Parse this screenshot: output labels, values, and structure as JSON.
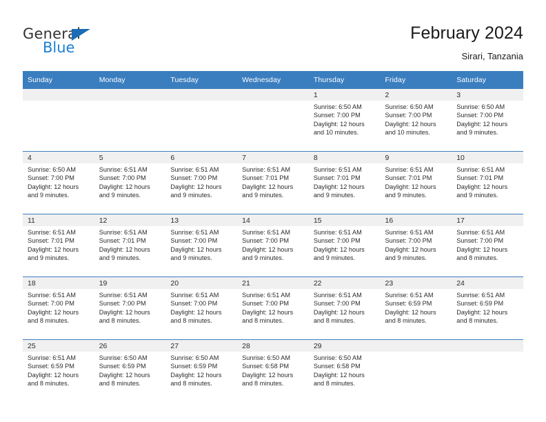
{
  "brand": {
    "name_top": "General",
    "name_bottom": "Blue",
    "triangle_color": "#1b6cb5",
    "blue_color": "#1b7fd4"
  },
  "header": {
    "title": "February 2024",
    "subtitle": "Sirari, Tanzania"
  },
  "theme": {
    "header_bg": "#3a7ebf",
    "daynum_band_bg": "#f0f0f0",
    "row_border": "#3a7ebf",
    "text": "#2b2b2b"
  },
  "weekdays": [
    "Sunday",
    "Monday",
    "Tuesday",
    "Wednesday",
    "Thursday",
    "Friday",
    "Saturday"
  ],
  "weeks": [
    [
      {
        "day": "",
        "empty": true,
        "sunrise": "",
        "sunset": "",
        "daylight_line1": "",
        "daylight_line2": ""
      },
      {
        "day": "",
        "empty": true,
        "sunrise": "",
        "sunset": "",
        "daylight_line1": "",
        "daylight_line2": ""
      },
      {
        "day": "",
        "empty": true,
        "sunrise": "",
        "sunset": "",
        "daylight_line1": "",
        "daylight_line2": ""
      },
      {
        "day": "",
        "empty": true,
        "sunrise": "",
        "sunset": "",
        "daylight_line1": "",
        "daylight_line2": ""
      },
      {
        "day": "1",
        "empty": false,
        "sunrise": "Sunrise: 6:50 AM",
        "sunset": "Sunset: 7:00 PM",
        "daylight_line1": "Daylight: 12 hours",
        "daylight_line2": "and 10 minutes."
      },
      {
        "day": "2",
        "empty": false,
        "sunrise": "Sunrise: 6:50 AM",
        "sunset": "Sunset: 7:00 PM",
        "daylight_line1": "Daylight: 12 hours",
        "daylight_line2": "and 10 minutes."
      },
      {
        "day": "3",
        "empty": false,
        "sunrise": "Sunrise: 6:50 AM",
        "sunset": "Sunset: 7:00 PM",
        "daylight_line1": "Daylight: 12 hours",
        "daylight_line2": "and 9 minutes."
      }
    ],
    [
      {
        "day": "4",
        "empty": false,
        "sunrise": "Sunrise: 6:50 AM",
        "sunset": "Sunset: 7:00 PM",
        "daylight_line1": "Daylight: 12 hours",
        "daylight_line2": "and 9 minutes."
      },
      {
        "day": "5",
        "empty": false,
        "sunrise": "Sunrise: 6:51 AM",
        "sunset": "Sunset: 7:00 PM",
        "daylight_line1": "Daylight: 12 hours",
        "daylight_line2": "and 9 minutes."
      },
      {
        "day": "6",
        "empty": false,
        "sunrise": "Sunrise: 6:51 AM",
        "sunset": "Sunset: 7:00 PM",
        "daylight_line1": "Daylight: 12 hours",
        "daylight_line2": "and 9 minutes."
      },
      {
        "day": "7",
        "empty": false,
        "sunrise": "Sunrise: 6:51 AM",
        "sunset": "Sunset: 7:01 PM",
        "daylight_line1": "Daylight: 12 hours",
        "daylight_line2": "and 9 minutes."
      },
      {
        "day": "8",
        "empty": false,
        "sunrise": "Sunrise: 6:51 AM",
        "sunset": "Sunset: 7:01 PM",
        "daylight_line1": "Daylight: 12 hours",
        "daylight_line2": "and 9 minutes."
      },
      {
        "day": "9",
        "empty": false,
        "sunrise": "Sunrise: 6:51 AM",
        "sunset": "Sunset: 7:01 PM",
        "daylight_line1": "Daylight: 12 hours",
        "daylight_line2": "and 9 minutes."
      },
      {
        "day": "10",
        "empty": false,
        "sunrise": "Sunrise: 6:51 AM",
        "sunset": "Sunset: 7:01 PM",
        "daylight_line1": "Daylight: 12 hours",
        "daylight_line2": "and 9 minutes."
      }
    ],
    [
      {
        "day": "11",
        "empty": false,
        "sunrise": "Sunrise: 6:51 AM",
        "sunset": "Sunset: 7:01 PM",
        "daylight_line1": "Daylight: 12 hours",
        "daylight_line2": "and 9 minutes."
      },
      {
        "day": "12",
        "empty": false,
        "sunrise": "Sunrise: 6:51 AM",
        "sunset": "Sunset: 7:01 PM",
        "daylight_line1": "Daylight: 12 hours",
        "daylight_line2": "and 9 minutes."
      },
      {
        "day": "13",
        "empty": false,
        "sunrise": "Sunrise: 6:51 AM",
        "sunset": "Sunset: 7:00 PM",
        "daylight_line1": "Daylight: 12 hours",
        "daylight_line2": "and 9 minutes."
      },
      {
        "day": "14",
        "empty": false,
        "sunrise": "Sunrise: 6:51 AM",
        "sunset": "Sunset: 7:00 PM",
        "daylight_line1": "Daylight: 12 hours",
        "daylight_line2": "and 9 minutes."
      },
      {
        "day": "15",
        "empty": false,
        "sunrise": "Sunrise: 6:51 AM",
        "sunset": "Sunset: 7:00 PM",
        "daylight_line1": "Daylight: 12 hours",
        "daylight_line2": "and 9 minutes."
      },
      {
        "day": "16",
        "empty": false,
        "sunrise": "Sunrise: 6:51 AM",
        "sunset": "Sunset: 7:00 PM",
        "daylight_line1": "Daylight: 12 hours",
        "daylight_line2": "and 9 minutes."
      },
      {
        "day": "17",
        "empty": false,
        "sunrise": "Sunrise: 6:51 AM",
        "sunset": "Sunset: 7:00 PM",
        "daylight_line1": "Daylight: 12 hours",
        "daylight_line2": "and 8 minutes."
      }
    ],
    [
      {
        "day": "18",
        "empty": false,
        "sunrise": "Sunrise: 6:51 AM",
        "sunset": "Sunset: 7:00 PM",
        "daylight_line1": "Daylight: 12 hours",
        "daylight_line2": "and 8 minutes."
      },
      {
        "day": "19",
        "empty": false,
        "sunrise": "Sunrise: 6:51 AM",
        "sunset": "Sunset: 7:00 PM",
        "daylight_line1": "Daylight: 12 hours",
        "daylight_line2": "and 8 minutes."
      },
      {
        "day": "20",
        "empty": false,
        "sunrise": "Sunrise: 6:51 AM",
        "sunset": "Sunset: 7:00 PM",
        "daylight_line1": "Daylight: 12 hours",
        "daylight_line2": "and 8 minutes."
      },
      {
        "day": "21",
        "empty": false,
        "sunrise": "Sunrise: 6:51 AM",
        "sunset": "Sunset: 7:00 PM",
        "daylight_line1": "Daylight: 12 hours",
        "daylight_line2": "and 8 minutes."
      },
      {
        "day": "22",
        "empty": false,
        "sunrise": "Sunrise: 6:51 AM",
        "sunset": "Sunset: 7:00 PM",
        "daylight_line1": "Daylight: 12 hours",
        "daylight_line2": "and 8 minutes."
      },
      {
        "day": "23",
        "empty": false,
        "sunrise": "Sunrise: 6:51 AM",
        "sunset": "Sunset: 6:59 PM",
        "daylight_line1": "Daylight: 12 hours",
        "daylight_line2": "and 8 minutes."
      },
      {
        "day": "24",
        "empty": false,
        "sunrise": "Sunrise: 6:51 AM",
        "sunset": "Sunset: 6:59 PM",
        "daylight_line1": "Daylight: 12 hours",
        "daylight_line2": "and 8 minutes."
      }
    ],
    [
      {
        "day": "25",
        "empty": false,
        "sunrise": "Sunrise: 6:51 AM",
        "sunset": "Sunset: 6:59 PM",
        "daylight_line1": "Daylight: 12 hours",
        "daylight_line2": "and 8 minutes."
      },
      {
        "day": "26",
        "empty": false,
        "sunrise": "Sunrise: 6:50 AM",
        "sunset": "Sunset: 6:59 PM",
        "daylight_line1": "Daylight: 12 hours",
        "daylight_line2": "and 8 minutes."
      },
      {
        "day": "27",
        "empty": false,
        "sunrise": "Sunrise: 6:50 AM",
        "sunset": "Sunset: 6:59 PM",
        "daylight_line1": "Daylight: 12 hours",
        "daylight_line2": "and 8 minutes."
      },
      {
        "day": "28",
        "empty": false,
        "sunrise": "Sunrise: 6:50 AM",
        "sunset": "Sunset: 6:58 PM",
        "daylight_line1": "Daylight: 12 hours",
        "daylight_line2": "and 8 minutes."
      },
      {
        "day": "29",
        "empty": false,
        "sunrise": "Sunrise: 6:50 AM",
        "sunset": "Sunset: 6:58 PM",
        "daylight_line1": "Daylight: 12 hours",
        "daylight_line2": "and 8 minutes."
      },
      {
        "day": "",
        "empty": true,
        "sunrise": "",
        "sunset": "",
        "daylight_line1": "",
        "daylight_line2": ""
      },
      {
        "day": "",
        "empty": true,
        "sunrise": "",
        "sunset": "",
        "daylight_line1": "",
        "daylight_line2": ""
      }
    ]
  ]
}
